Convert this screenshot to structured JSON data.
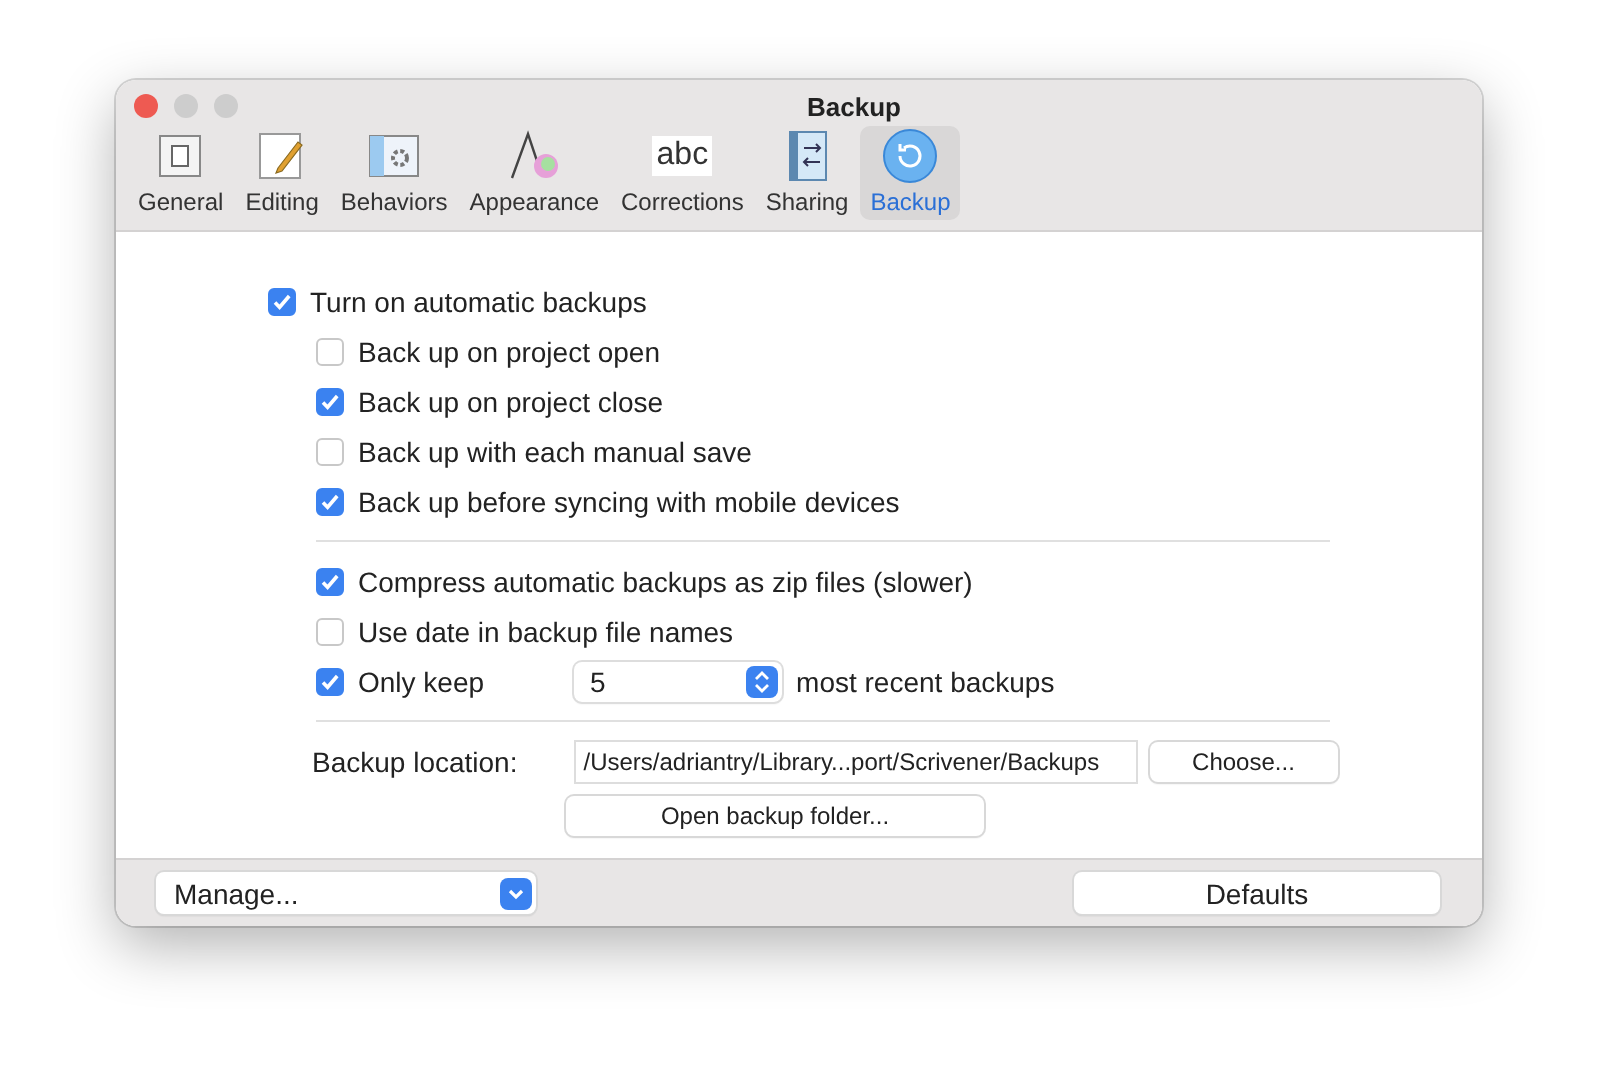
{
  "window": {
    "title": "Backup"
  },
  "tabs": [
    {
      "label": "General",
      "kind": "general",
      "selected": false
    },
    {
      "label": "Editing",
      "kind": "editing",
      "selected": false
    },
    {
      "label": "Behaviors",
      "kind": "behaviors",
      "selected": false
    },
    {
      "label": "Appearance",
      "kind": "appearance",
      "selected": false
    },
    {
      "label": "Corrections",
      "kind": "corrections",
      "icon_text": "abc",
      "selected": false
    },
    {
      "label": "Sharing",
      "kind": "sharing",
      "selected": false
    },
    {
      "label": "Backup",
      "kind": "backup",
      "selected": true
    }
  ],
  "main_option": {
    "label": "Turn on automatic backups",
    "checked": true
  },
  "backup_triggers": [
    {
      "label": "Back up on project open",
      "checked": false
    },
    {
      "label": "Back up on project close",
      "checked": true
    },
    {
      "label": "Back up with each manual save",
      "checked": false
    },
    {
      "label": "Back up before syncing with mobile devices",
      "checked": true
    }
  ],
  "backup_options": [
    {
      "label": "Compress automatic backups as zip files (slower)",
      "checked": true
    },
    {
      "label": "Use date in backup file names",
      "checked": false
    }
  ],
  "only_keep": {
    "label": "Only keep",
    "checked": true,
    "value": "5",
    "suffix": "most recent backups"
  },
  "location": {
    "label": "Backup location:",
    "path": "/Users/adriantry/Library...port/Scrivener/Backups",
    "choose_button": "Choose...",
    "open_button": "Open backup folder..."
  },
  "footer": {
    "manage": "Manage...",
    "defaults": "Defaults"
  }
}
